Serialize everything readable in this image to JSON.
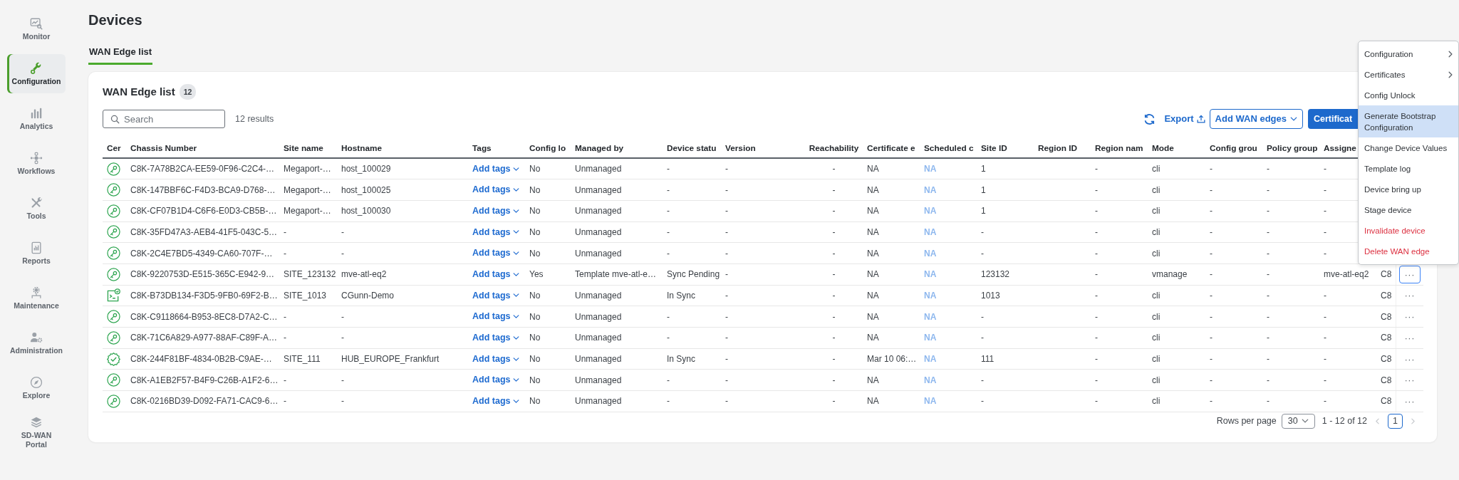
{
  "sidebar": {
    "items": [
      {
        "label": "Monitor",
        "selected": false
      },
      {
        "label": "Configuration",
        "selected": true
      },
      {
        "label": "Analytics",
        "selected": false
      },
      {
        "label": "Workflows",
        "selected": false
      },
      {
        "label": "Tools",
        "selected": false
      },
      {
        "label": "Reports",
        "selected": false
      },
      {
        "label": "Maintenance",
        "selected": false
      },
      {
        "label": "Administration",
        "selected": false
      },
      {
        "label": "Explore",
        "selected": false
      },
      {
        "label": "SD-WAN Portal",
        "selected": false
      }
    ]
  },
  "page": {
    "title": "Devices"
  },
  "tabs": [
    {
      "label": "WAN Edge list",
      "selected": true
    }
  ],
  "card": {
    "title": "WAN Edge list",
    "count": "12",
    "search": {
      "placeholder": "Search"
    },
    "results": "12 results",
    "toolbar": {
      "export": "Export",
      "add_button": "Add WAN edges",
      "primary_button": "Certificat"
    }
  },
  "table": {
    "columns": [
      {
        "label": "Cer",
        "kind": "icon"
      },
      {
        "label": "Chassis Number",
        "kind": "text"
      },
      {
        "label": "Site name",
        "kind": "text"
      },
      {
        "label": "Hostname",
        "kind": "text"
      },
      {
        "label": "Tags",
        "kind": "dropdown"
      },
      {
        "label": "Config lo",
        "kind": "text"
      },
      {
        "label": "Managed by",
        "kind": "text"
      },
      {
        "label": "Device statu",
        "kind": "text"
      },
      {
        "label": "Version",
        "kind": "text"
      },
      {
        "label": "Reachability",
        "kind": "center"
      },
      {
        "label": "Certificate e",
        "kind": "text"
      },
      {
        "label": "Scheduled c",
        "kind": "faded"
      },
      {
        "label": "Site ID",
        "kind": "text"
      },
      {
        "label": "Region ID",
        "kind": "text"
      },
      {
        "label": "Region nam",
        "kind": "text"
      },
      {
        "label": "Mode",
        "kind": "text"
      },
      {
        "label": "Config grou",
        "kind": "text"
      },
      {
        "label": "Policy group",
        "kind": "text"
      },
      {
        "label": "Assigne",
        "kind": "text"
      },
      {
        "kind": "text"
      }
    ],
    "rows": [
      {
        "kind": "key",
        "cells": [
          "",
          "C8K-7A78B2CA-EE59-0F96-C2C4-…",
          "Megaport-…",
          "host_100029",
          "Add tags",
          "No",
          "Unmanaged",
          "-",
          "-",
          "-",
          "NA",
          "NA",
          "1",
          "",
          "-",
          "cli",
          "-",
          "-",
          "-"
        ]
      },
      {
        "kind": "key",
        "cells": [
          "",
          "C8K-147BBF6C-F4D3-BCA9-D768-…",
          "Megaport-…",
          "host_100025",
          "Add tags",
          "No",
          "Unmanaged",
          "-",
          "-",
          "-",
          "NA",
          "NA",
          "1",
          "",
          "-",
          "cli",
          "-",
          "-",
          "-"
        ]
      },
      {
        "kind": "key",
        "cells": [
          "",
          "C8K-CF07B1D4-C6F6-E0D3-CB5B-…",
          "Megaport-…",
          "host_100030",
          "Add tags",
          "No",
          "Unmanaged",
          "-",
          "-",
          "-",
          "NA",
          "NA",
          "1",
          "",
          "-",
          "cli",
          "-",
          "-",
          "-"
        ]
      },
      {
        "kind": "key",
        "cells": [
          "",
          "C8K-35FD47A3-AEB4-41F5-043C-5…",
          "-",
          "-",
          "Add tags",
          "No",
          "Unmanaged",
          "-",
          "-",
          "-",
          "NA",
          "NA",
          "-",
          "",
          "-",
          "cli",
          "-",
          "-",
          "-"
        ]
      },
      {
        "kind": "key",
        "cells": [
          "",
          "C8K-2C4E7BD5-4349-CA60-707F-…",
          "-",
          "-",
          "Add tags",
          "No",
          "Unmanaged",
          "-",
          "-",
          "-",
          "NA",
          "NA",
          "-",
          "",
          "-",
          "cli",
          "-",
          "-",
          "-"
        ]
      },
      {
        "kind": "key",
        "cells": [
          "",
          "C8K-9220753D-E515-365C-E942-9…",
          "SITE_123132",
          "mve-atl-eq2",
          "Add tags",
          "Yes",
          "Template mve-atl-e…",
          "Sync Pending",
          "-",
          "-",
          "NA",
          "NA",
          "123132",
          "",
          "-",
          "vmanage",
          "-",
          "-",
          "mve-atl-eq2",
          "C8"
        ],
        "actions": "···",
        "expanded": true
      },
      {
        "kind": "console",
        "cells": [
          "",
          "C8K-B73DB134-F3D5-9FB0-69F2-B…",
          "SITE_1013",
          "CGunn-Demo",
          "Add tags",
          "No",
          "Unmanaged",
          "In Sync",
          "-",
          "-",
          "NA",
          "NA",
          "1013",
          "",
          "-",
          "cli",
          "-",
          "-",
          "-",
          "C8"
        ],
        "actions": "···",
        "expanded": false
      },
      {
        "kind": "key",
        "cells": [
          "",
          "C8K-C9118664-B953-8EC8-D7A2-C…",
          "-",
          "-",
          "Add tags",
          "No",
          "Unmanaged",
          "-",
          "-",
          "-",
          "NA",
          "NA",
          "-",
          "",
          "-",
          "cli",
          "-",
          "-",
          "-",
          "C8"
        ],
        "actions": "···",
        "expanded": false
      },
      {
        "kind": "key",
        "cells": [
          "",
          "C8K-71C6A829-A977-88AF-C89F-A…",
          "-",
          "-",
          "Add tags",
          "No",
          "Unmanaged",
          "-",
          "-",
          "-",
          "NA",
          "NA",
          "-",
          "",
          "-",
          "cli",
          "-",
          "-",
          "-",
          "C8"
        ],
        "actions": "···",
        "expanded": false
      },
      {
        "kind": "verified",
        "cells": [
          "",
          "C8K-244F81BF-4834-0B2B-C9AE-…",
          "SITE_111",
          "HUB_EUROPE_Frankfurt",
          "Add tags",
          "No",
          "Unmanaged",
          "In Sync",
          "-",
          "-",
          "Mar 10 06:…",
          "NA",
          "111",
          "",
          "-",
          "cli",
          "-",
          "-",
          "-",
          "C8"
        ],
        "actions": "···",
        "expanded": false
      },
      {
        "kind": "key",
        "cells": [
          "",
          "C8K-A1EB2F57-B4F9-C26B-A1F2-6…",
          "-",
          "-",
          "Add tags",
          "No",
          "Unmanaged",
          "-",
          "-",
          "-",
          "NA",
          "NA",
          "-",
          "",
          "-",
          "cli",
          "-",
          "-",
          "-",
          "C8"
        ],
        "actions": "···",
        "expanded": false
      },
      {
        "kind": "key",
        "cells": [
          "",
          "C8K-0216BD39-D092-FA71-CAC9-6…",
          "-",
          "-",
          "Add tags",
          "No",
          "Unmanaged",
          "-",
          "-",
          "-",
          "NA",
          "NA",
          "-",
          "",
          "-",
          "cli",
          "-",
          "-",
          "-",
          "C8"
        ],
        "actions": "···",
        "expanded": false
      }
    ]
  },
  "pagination": {
    "rows_label": "Rows per page",
    "rows_per_page": "30",
    "range": "1 - 12 of 12",
    "previous": {
      "disabled": true
    },
    "next": {
      "disabled": true
    },
    "pages": [
      {
        "label": "1",
        "selected": true
      }
    ]
  },
  "menu": {
    "items": [
      {
        "label": "Configuration",
        "kind": "submenu",
        "selected": false
      },
      {
        "label": "Certificates",
        "kind": "submenu",
        "selected": false
      },
      {
        "label": "Config Unlock",
        "kind": "item",
        "selected": false
      },
      {
        "label": "Generate Bootstrap Configuration",
        "kind": "item",
        "selected": true
      },
      {
        "label": "Change Device Values",
        "kind": "item",
        "selected": false
      },
      {
        "label": "Template log",
        "kind": "item",
        "selected": false
      },
      {
        "label": "Device bring up",
        "kind": "item",
        "selected": false
      },
      {
        "label": "Stage device",
        "kind": "item",
        "selected": false
      },
      {
        "label": "Invalidate device",
        "kind": "danger",
        "selected": false
      },
      {
        "label": "Delete WAN edge",
        "kind": "danger",
        "selected": false
      }
    ]
  }
}
